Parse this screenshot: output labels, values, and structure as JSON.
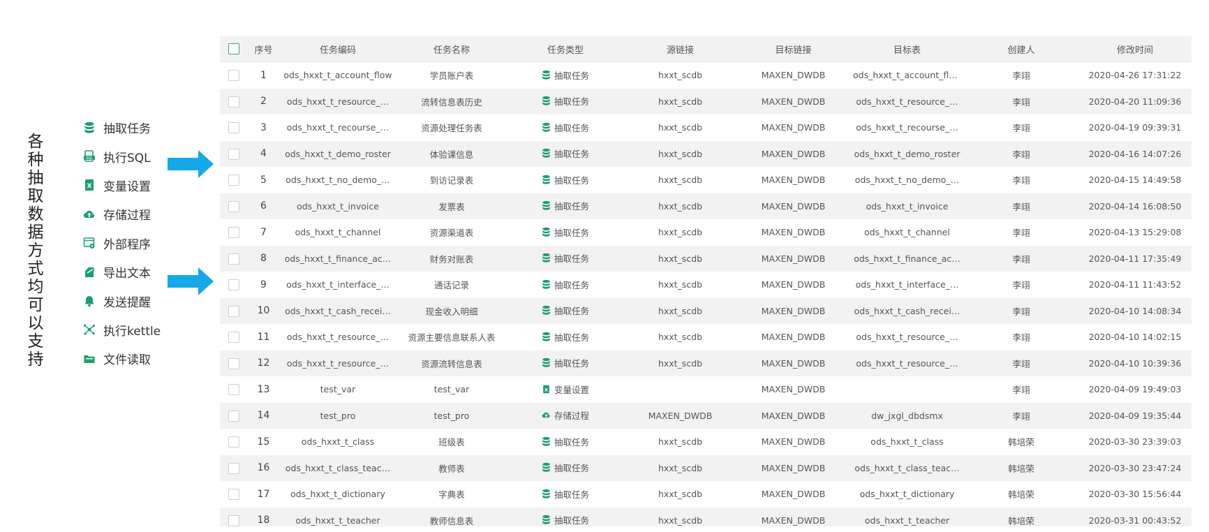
{
  "side_title": "各种抽取数据方式均可以支持",
  "types": [
    {
      "icon": "database-icon",
      "label": "抽取任务"
    },
    {
      "icon": "sql-file-icon",
      "label": "执行SQL"
    },
    {
      "icon": "excel-icon",
      "label": "变量设置"
    },
    {
      "icon": "cloud-upload-icon",
      "label": "存储过程"
    },
    {
      "icon": "window-gear-icon",
      "label": "外部程序"
    },
    {
      "icon": "export-text-icon",
      "label": "导出文本"
    },
    {
      "icon": "bell-icon",
      "label": "发送提醒"
    },
    {
      "icon": "kettle-icon",
      "label": "执行kettle"
    },
    {
      "icon": "folder-icon",
      "label": "文件读取"
    }
  ],
  "colors": {
    "accent": "#1aa06a",
    "arrow": "#16a9e8",
    "stripe": "#f2f2f2"
  },
  "table": {
    "headers": [
      "序号",
      "任务编码",
      "任务名称",
      "任务类型",
      "源链接",
      "目标链接",
      "目标表",
      "创建人",
      "修改时间"
    ],
    "rows": [
      {
        "seq": "1",
        "code": "ods_hxxt_t_account_flow",
        "name": "学员账户表",
        "type": "抽取任务",
        "type_icon": "database-icon",
        "src": "hxxt_scdb",
        "tgt": "MAXEN_DWDB",
        "table": "ods_hxxt_t_account_flow",
        "creator": "李翊",
        "time": "2020-04-26 17:31:22"
      },
      {
        "seq": "2",
        "code": "ods_hxxt_t_resource_…",
        "name": "流转信息表历史",
        "type": "抽取任务",
        "type_icon": "database-icon",
        "src": "hxxt_scdb",
        "tgt": "MAXEN_DWDB",
        "table": "ods_hxxt_t_resource_…",
        "creator": "李翊",
        "time": "2020-04-20 11:09:36"
      },
      {
        "seq": "3",
        "code": "ods_hxxt_t_recourse_…",
        "name": "资源处理任务表",
        "type": "抽取任务",
        "type_icon": "database-icon",
        "src": "hxxt_scdb",
        "tgt": "MAXEN_DWDB",
        "table": "ods_hxxt_t_recourse_…",
        "creator": "李翊",
        "time": "2020-04-19 09:39:31"
      },
      {
        "seq": "4",
        "code": "ods_hxxt_t_demo_roster",
        "name": "体验课信息",
        "type": "抽取任务",
        "type_icon": "database-icon",
        "src": "hxxt_scdb",
        "tgt": "MAXEN_DWDB",
        "table": "ods_hxxt_t_demo_roster",
        "creator": "李翊",
        "time": "2020-04-16 14:07:26"
      },
      {
        "seq": "5",
        "code": "ods_hxxt_t_no_demo_…",
        "name": "到访记录表",
        "type": "抽取任务",
        "type_icon": "database-icon",
        "src": "hxxt_scdb",
        "tgt": "MAXEN_DWDB",
        "table": "ods_hxxt_t_no_demo_…",
        "creator": "李翊",
        "time": "2020-04-15 14:49:58"
      },
      {
        "seq": "6",
        "code": "ods_hxxt_t_invoice",
        "name": "发票表",
        "type": "抽取任务",
        "type_icon": "database-icon",
        "src": "hxxt_scdb",
        "tgt": "MAXEN_DWDB",
        "table": "ods_hxxt_t_invoice",
        "creator": "李翊",
        "time": "2020-04-14 16:08:50"
      },
      {
        "seq": "7",
        "code": "ods_hxxt_t_channel",
        "name": "资源渠道表",
        "type": "抽取任务",
        "type_icon": "database-icon",
        "src": "hxxt_scdb",
        "tgt": "MAXEN_DWDB",
        "table": "ods_hxxt_t_channel",
        "creator": "李翊",
        "time": "2020-04-13 15:29:08"
      },
      {
        "seq": "8",
        "code": "ods_hxxt_t_finance_ac…",
        "name": "财务对账表",
        "type": "抽取任务",
        "type_icon": "database-icon",
        "src": "hxxt_scdb",
        "tgt": "MAXEN_DWDB",
        "table": "ods_hxxt_t_finance_ac…",
        "creator": "李翊",
        "time": "2020-04-11 17:35:49"
      },
      {
        "seq": "9",
        "code": "ods_hxxt_t_interface_…",
        "name": "通话记录",
        "type": "抽取任务",
        "type_icon": "database-icon",
        "src": "hxxt_scdb",
        "tgt": "MAXEN_DWDB",
        "table": "ods_hxxt_t_interface_…",
        "creator": "李翊",
        "time": "2020-04-11 11:43:52"
      },
      {
        "seq": "10",
        "code": "ods_hxxt_t_cash_recei…",
        "name": "现金收入明细",
        "type": "抽取任务",
        "type_icon": "database-icon",
        "src": "hxxt_scdb",
        "tgt": "MAXEN_DWDB",
        "table": "ods_hxxt_t_cash_recei…",
        "creator": "李翊",
        "time": "2020-04-10 14:08:34"
      },
      {
        "seq": "11",
        "code": "ods_hxxt_t_resource_…",
        "name": "资源主要信息联系人表",
        "type": "抽取任务",
        "type_icon": "database-icon",
        "src": "hxxt_scdb",
        "tgt": "MAXEN_DWDB",
        "table": "ods_hxxt_t_resource_…",
        "creator": "李翊",
        "time": "2020-04-10 14:02:15"
      },
      {
        "seq": "12",
        "code": "ods_hxxt_t_resource_…",
        "name": "资源流转信息表",
        "type": "抽取任务",
        "type_icon": "database-icon",
        "src": "hxxt_scdb",
        "tgt": "MAXEN_DWDB",
        "table": "ods_hxxt_t_resource_…",
        "creator": "李翊",
        "time": "2020-04-10 10:39:36"
      },
      {
        "seq": "13",
        "code": "test_var",
        "name": "test_var",
        "type": "变量设置",
        "type_icon": "excel-icon",
        "src": "",
        "tgt": "MAXEN_DWDB",
        "table": "",
        "creator": "李翊",
        "time": "2020-04-09 19:49:03"
      },
      {
        "seq": "14",
        "code": "test_pro",
        "name": "test_pro",
        "type": "存储过程",
        "type_icon": "cloud-upload-icon",
        "src": "MAXEN_DWDB",
        "tgt": "MAXEN_DWDB",
        "table": "dw_jxgl_dbdsmx",
        "creator": "李翊",
        "time": "2020-04-09 19:35:44"
      },
      {
        "seq": "15",
        "code": "ods_hxxt_t_class",
        "name": "班级表",
        "type": "抽取任务",
        "type_icon": "database-icon",
        "src": "hxxt_scdb",
        "tgt": "MAXEN_DWDB",
        "table": "ods_hxxt_t_class",
        "creator": "韩培荣",
        "time": "2020-03-30 23:39:03"
      },
      {
        "seq": "16",
        "code": "ods_hxxt_t_class_teac…",
        "name": "教师表",
        "type": "抽取任务",
        "type_icon": "database-icon",
        "src": "hxxt_scdb",
        "tgt": "MAXEN_DWDB",
        "table": "ods_hxxt_t_class_teac…",
        "creator": "韩培荣",
        "time": "2020-03-30 23:47:24"
      },
      {
        "seq": "17",
        "code": "ods_hxxt_t_dictionary",
        "name": "字典表",
        "type": "抽取任务",
        "type_icon": "database-icon",
        "src": "hxxt_scdb",
        "tgt": "MAXEN_DWDB",
        "table": "ods_hxxt_t_dictionary",
        "creator": "韩培荣",
        "time": "2020-03-30 15:56:44"
      },
      {
        "seq": "18",
        "code": "ods_hxxt_t_teacher",
        "name": "教师信息表",
        "type": "抽取任务",
        "type_icon": "database-icon",
        "src": "hxxt_scdb",
        "tgt": "MAXEN_DWDB",
        "table": "ods_hxxt_t_teacher",
        "creator": "韩培荣",
        "time": "2020-03-31 00:43:52"
      }
    ]
  }
}
